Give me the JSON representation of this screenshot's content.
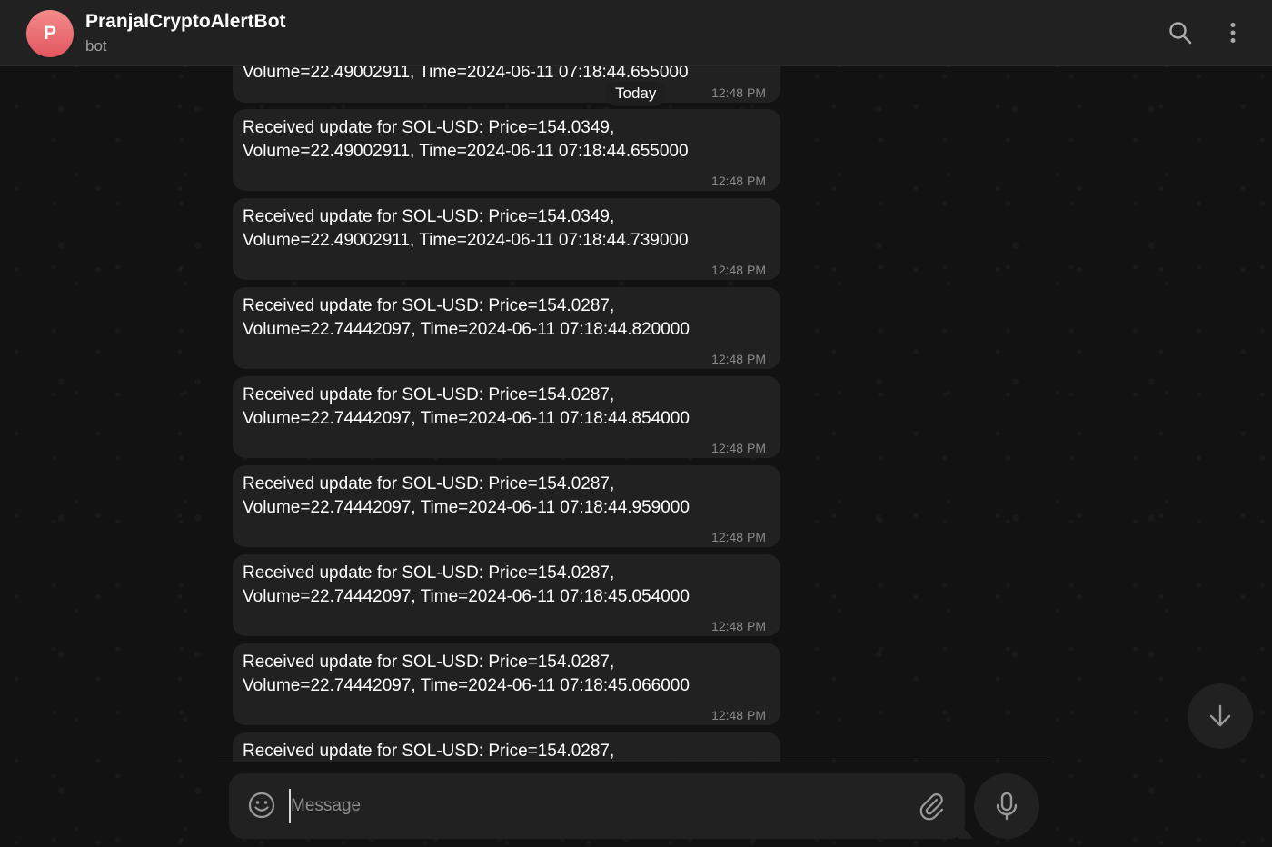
{
  "header": {
    "avatar_letter": "P",
    "title": "PranjalCryptoAlertBot",
    "subtitle": "bot",
    "search_icon": "search-icon",
    "more_icon": "more-vertical-icon"
  },
  "date_divider": "Today",
  "messages": [
    {
      "text": "Volume=22.49002911, Time=2024-06-11 07:18:44.655000",
      "time": "12:48 PM"
    },
    {
      "text": "Received update for SOL-USD: Price=154.0349,\nVolume=22.49002911, Time=2024-06-11 07:18:44.655000",
      "time": "12:48 PM"
    },
    {
      "text": "Received update for SOL-USD: Price=154.0349,\nVolume=22.49002911, Time=2024-06-11 07:18:44.739000",
      "time": "12:48 PM"
    },
    {
      "text": "Received update for SOL-USD: Price=154.0287,\nVolume=22.74442097, Time=2024-06-11 07:18:44.820000",
      "time": "12:48 PM"
    },
    {
      "text": "Received update for SOL-USD: Price=154.0287,\nVolume=22.74442097, Time=2024-06-11 07:18:44.854000",
      "time": "12:48 PM"
    },
    {
      "text": "Received update for SOL-USD: Price=154.0287,\nVolume=22.74442097, Time=2024-06-11 07:18:44.959000",
      "time": "12:48 PM"
    },
    {
      "text": "Received update for SOL-USD: Price=154.0287,\nVolume=22.74442097, Time=2024-06-11 07:18:45.054000",
      "time": "12:48 PM"
    },
    {
      "text": "Received update for SOL-USD: Price=154.0287,\nVolume=22.74442097, Time=2024-06-11 07:18:45.066000",
      "time": "12:48 PM"
    },
    {
      "text": "Received update for SOL-USD: Price=154.0287,",
      "time": ""
    }
  ],
  "composer": {
    "placeholder": "Message",
    "value": "",
    "emoji_icon": "smiley-icon",
    "attach_icon": "paperclip-icon",
    "mic_icon": "microphone-icon"
  },
  "scroll_down_icon": "arrow-down-icon",
  "colors": {
    "header_bg": "#212121",
    "bubble_bg": "#212121",
    "background": "#121212",
    "avatar_top": "#f58b8b",
    "avatar_bottom": "#e0575f",
    "text_primary": "#ffffff",
    "text_secondary": "#8a8a8a"
  }
}
